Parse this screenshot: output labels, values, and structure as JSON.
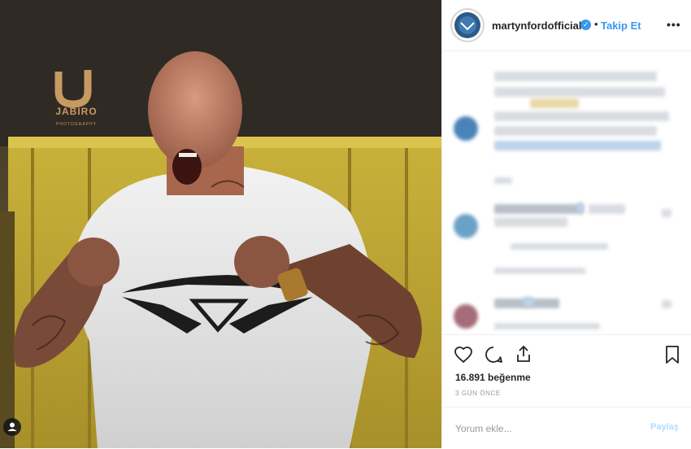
{
  "photo": {
    "watermark_text": "JABIRO",
    "watermark_subtext": "PHOTOGRAPHY"
  },
  "header": {
    "username": "martynfordofficial",
    "separator": "•",
    "follow_label": "Takip Et",
    "more_label": "•••"
  },
  "post": {
    "likes_text": "16.891 beğenme",
    "date_text": "3 GÜN ÖNCE"
  },
  "comment_box": {
    "placeholder": "Yorum ekle...",
    "submit_label": "Paylaş"
  },
  "icons": {
    "like": "heart-icon",
    "comment": "comment-icon",
    "share": "share-icon",
    "save": "bookmark-icon",
    "user_tag": "user-tag-icon",
    "verified": "verified-badge-icon"
  },
  "colors": {
    "accent": "#3897f0",
    "text": "#262626",
    "muted": "#999999",
    "disabled_submit": "#b3dbff"
  }
}
